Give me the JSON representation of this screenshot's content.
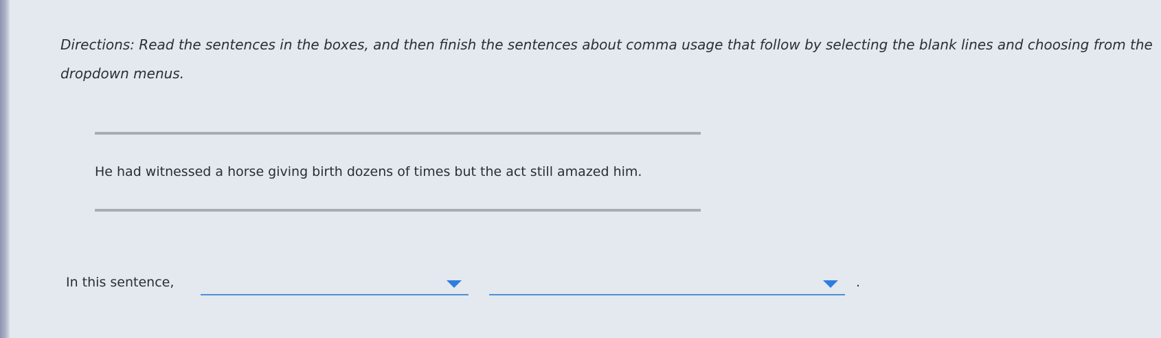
{
  "directions": {
    "text": "Directions: Read the sentences in the boxes, and then finish the sentences about comma usage that follow by selecting the blank lines and choosing from the dropdown menus."
  },
  "passage": {
    "sentence": "He had witnessed a horse giving birth dozens of times but the act still amazed him."
  },
  "question": {
    "prefix": "In this sentence,",
    "dropdown_1": {
      "selected": "",
      "icon": "caret-down-icon",
      "underline_color": "#4a8fd8"
    },
    "dropdown_2": {
      "selected": "",
      "icon": "caret-down-icon",
      "underline_color": "#4a8fd8"
    },
    "suffix": "."
  }
}
